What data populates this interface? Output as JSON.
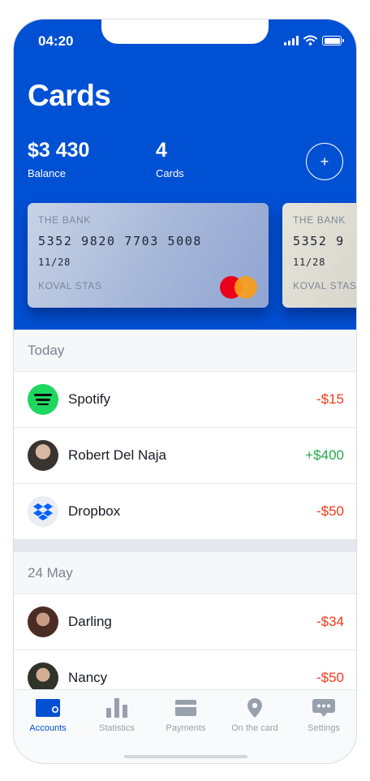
{
  "status_bar": {
    "time": "04:20",
    "icons": [
      "signal-icon",
      "wifi-icon",
      "battery-icon"
    ]
  },
  "page_title": "Cards",
  "summary": {
    "balance_value": "$3 430",
    "balance_label": "Balance",
    "cards_value": "4",
    "cards_label": "Cards",
    "add_label": "+"
  },
  "cards": [
    {
      "bank": "THE BANK",
      "number": "5352 9820 7703 5008",
      "expiry": "11/28",
      "holder": "KOVAL STAS",
      "brand_icon": "mastercard-icon"
    },
    {
      "bank": "THE BANK",
      "number": "5352 9",
      "expiry": "11/28",
      "holder": "KOVAL STAS"
    }
  ],
  "sections": [
    {
      "title": "Today",
      "transactions": [
        {
          "name": "Spotify",
          "amount": "-$15",
          "icon": "spotify-icon"
        },
        {
          "name": "Robert Del Naja",
          "amount": "+$400",
          "icon": "avatar-photo"
        },
        {
          "name": "Dropbox",
          "amount": "-$50",
          "icon": "dropbox-icon"
        }
      ]
    },
    {
      "title": "24 May",
      "transactions": [
        {
          "name": "Darling",
          "amount": "-$34",
          "icon": "avatar-photo"
        },
        {
          "name": "Nancy",
          "amount": "-$50",
          "icon": "avatar-photo"
        }
      ]
    }
  ],
  "tabbar": {
    "tabs": [
      {
        "label": "Accounts",
        "icon": "wallet-icon",
        "active": true
      },
      {
        "label": "Statistics",
        "icon": "bar-chart-icon"
      },
      {
        "label": "Payments",
        "icon": "credit-card-icon"
      },
      {
        "label": "On the card",
        "icon": "location-pin-icon"
      },
      {
        "label": "Settings",
        "icon": "more-dots-icon"
      }
    ]
  },
  "colors": {
    "brand": "#0050d4",
    "negative": "#f2391b",
    "positive": "#22a94c",
    "spotify": "#1ed760",
    "dropbox": "#0061fe",
    "inactive": "#98a0ad"
  }
}
